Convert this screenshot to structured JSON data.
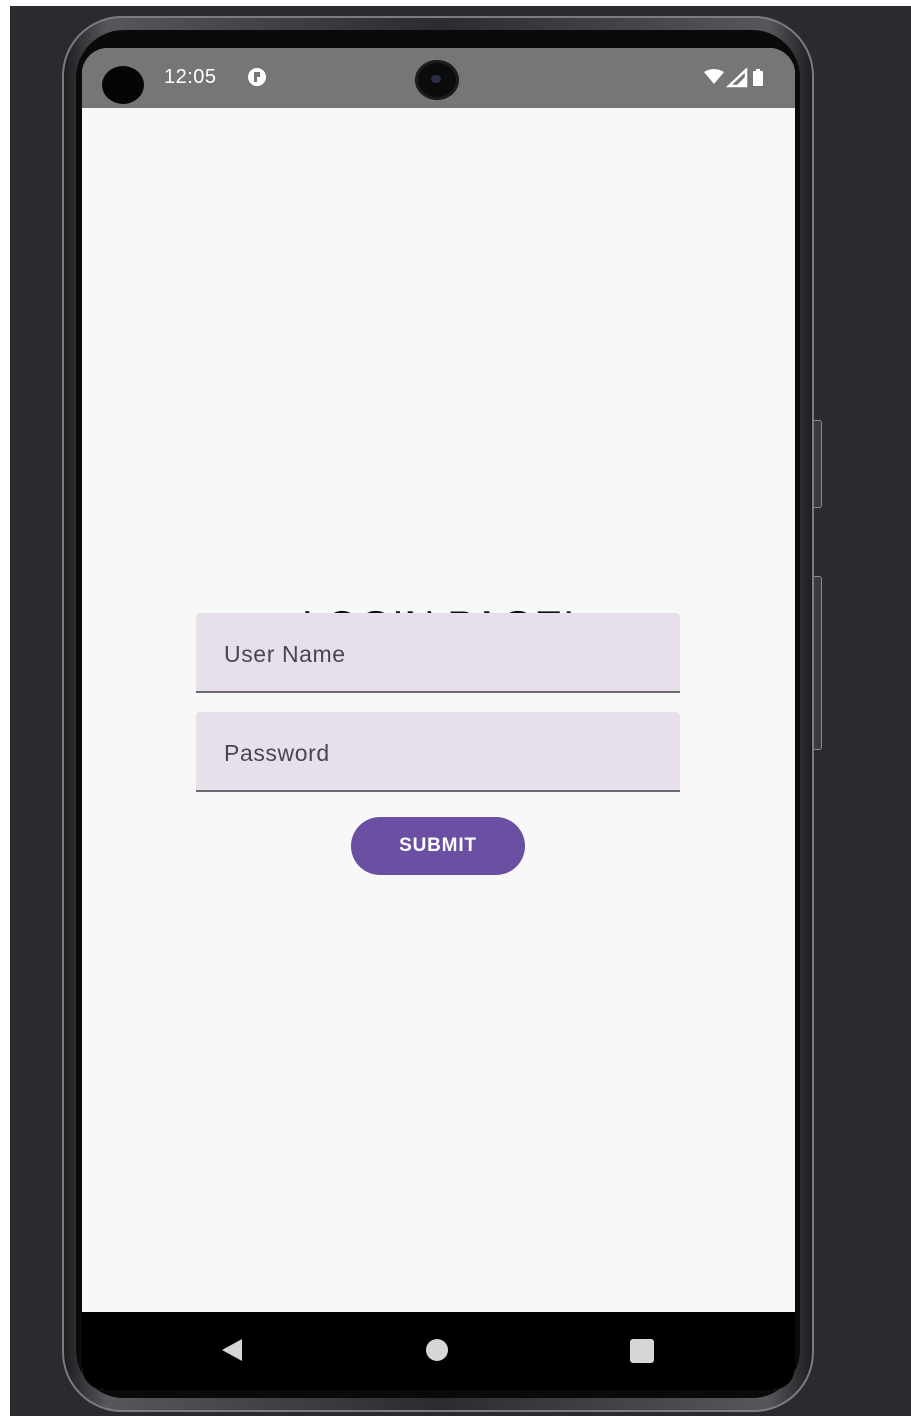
{
  "status_bar": {
    "time": "12:05",
    "notification_icon": "notification-badge-icon",
    "icons": [
      "wifi-icon",
      "cellular-signal-icon",
      "battery-icon"
    ]
  },
  "login": {
    "title": "LOGIN PAGE!",
    "username_placeholder": "User Name",
    "password_placeholder": "Password",
    "submit_label": "SUBMIT"
  },
  "navigation": {
    "icons": [
      "back-triangle-icon",
      "home-circle-icon",
      "recents-square-icon"
    ]
  },
  "colors": {
    "accent": "#6a4fa3",
    "field_background": "#e7dfea",
    "status_bar": "#767676",
    "screen_background": "#f8f8f9"
  }
}
